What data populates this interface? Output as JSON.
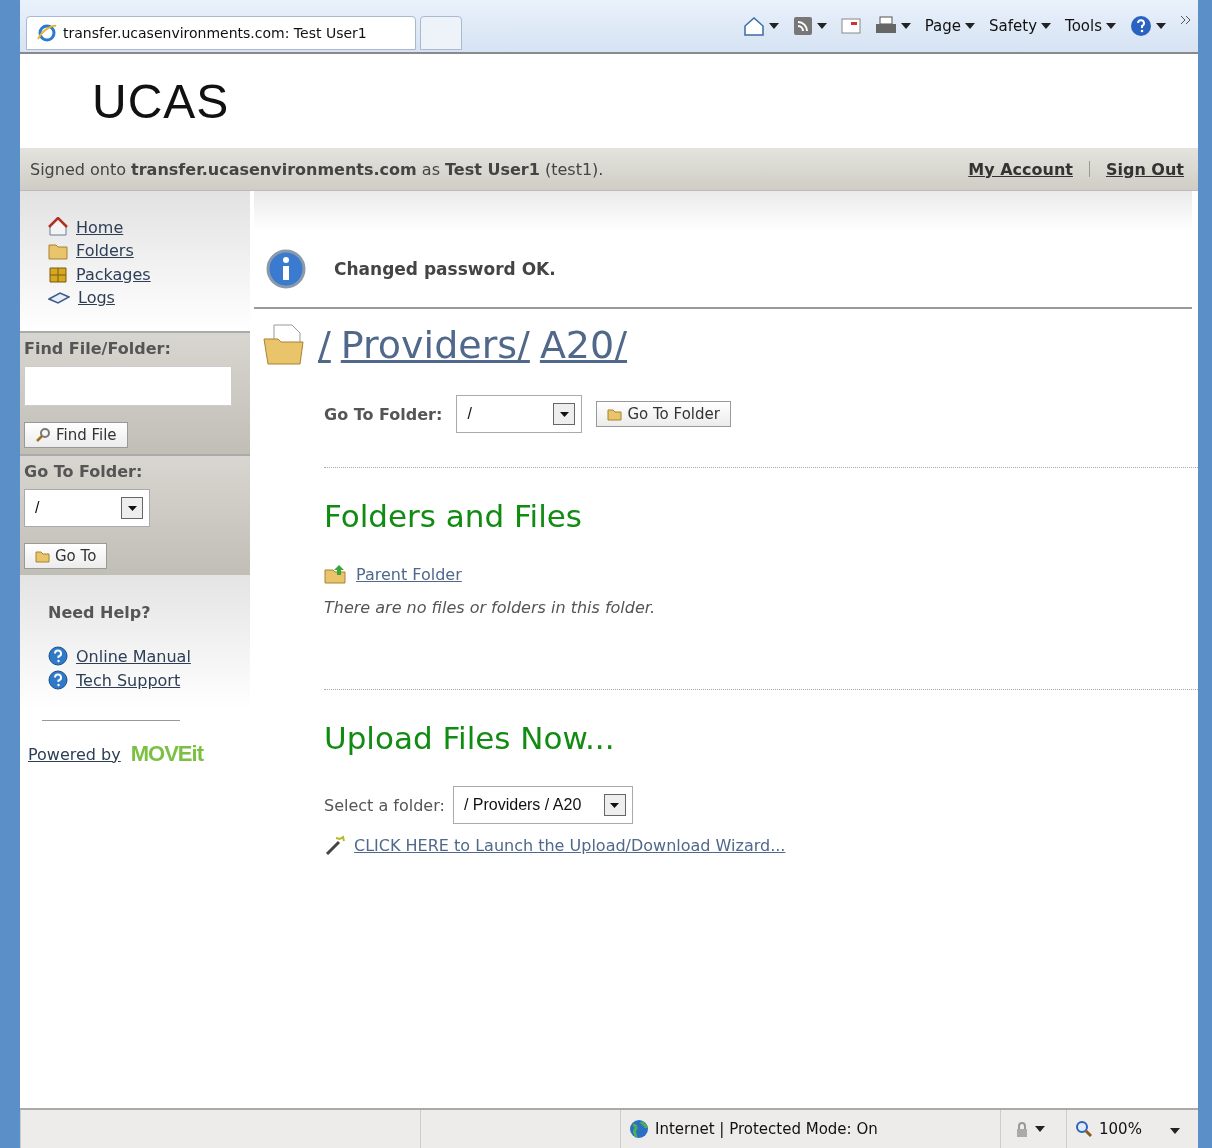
{
  "browser": {
    "tab_title": "transfer.ucasenvironments.com: Test User1",
    "toolbar": [
      {
        "kind": "home"
      },
      {
        "kind": "feed"
      },
      {
        "kind": "mail"
      },
      {
        "kind": "print"
      },
      {
        "kind": "menu",
        "label": "Page"
      },
      {
        "kind": "menu",
        "label": "Safety"
      },
      {
        "kind": "menu",
        "label": "Tools"
      },
      {
        "kind": "help"
      }
    ]
  },
  "header": {
    "logo": "UCAS",
    "signed_in": "Signed onto **transfer.ucasenvironments.com** as **Test User1** (test1).",
    "links": [
      "My Account",
      "Sign Out"
    ]
  },
  "sidebar": {
    "nav": [
      {
        "label": "Home",
        "kind": "home"
      },
      {
        "label": "Folders",
        "kind": "folder"
      },
      {
        "label": "Packages",
        "kind": "package"
      },
      {
        "label": "Logs",
        "kind": "book"
      }
    ],
    "find": {
      "label": "Find File/Folder:",
      "button": "Find File"
    },
    "goto": {
      "label": "Go To Folder:",
      "value": "/",
      "button": "Go To"
    },
    "help": {
      "title": "Need Help?",
      "links": [
        "Online Manual",
        "Tech Support"
      ]
    },
    "powered_by": {
      "text": "Powered by",
      "logo": "MOVEit"
    }
  },
  "main": {
    "message": "Changed password OK.",
    "breadcrumb": [
      "/",
      "Providers/",
      "A20/"
    ],
    "goto": {
      "label": "Go To Folder:",
      "value": "/",
      "button": "Go To Folder"
    },
    "folders": {
      "title": "Folders and Files",
      "parent_link": "Parent Folder",
      "empty_text": "There are no files or folders in this folder."
    },
    "upload": {
      "title": "Upload Files Now...",
      "select_label": "Select a folder:",
      "select_value": "/ Providers / A20",
      "wizard_link": "CLICK HERE to Launch the Upload/Download Wizard..."
    }
  },
  "status_bar": {
    "zone": "Internet | Protected Mode: On",
    "zoom": "100%"
  }
}
